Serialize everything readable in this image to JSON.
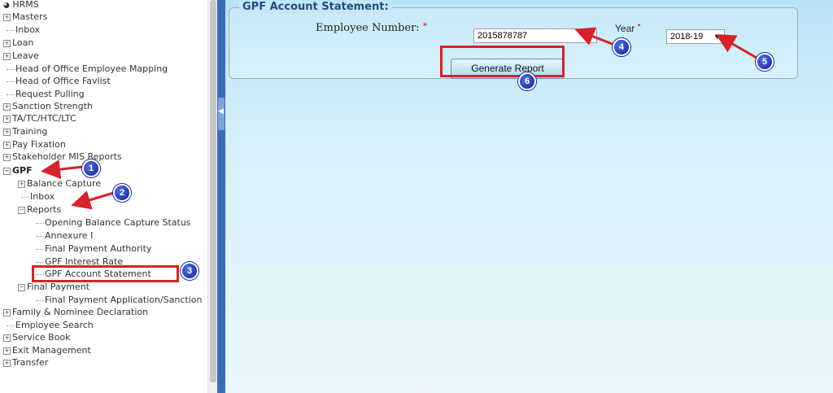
{
  "sidebar": {
    "items": [
      {
        "label": "HRMS",
        "prefix": "icon"
      },
      {
        "label": "Masters",
        "prefix": "plus"
      },
      {
        "label": "Inbox",
        "prefix": "dots"
      },
      {
        "label": "Loan",
        "prefix": "plus"
      },
      {
        "label": "Leave",
        "prefix": "plus"
      },
      {
        "label": "Head of Office Employee Mapping",
        "prefix": "dots"
      },
      {
        "label": "Head of Office Favlist",
        "prefix": "dots"
      },
      {
        "label": "Request Pulling",
        "prefix": "dots"
      },
      {
        "label": "Sanction Strength",
        "prefix": "plus"
      },
      {
        "label": "TA/TC/HTC/LTC",
        "prefix": "plus"
      },
      {
        "label": "Training",
        "prefix": "plus"
      },
      {
        "label": "Pay Fixation",
        "prefix": "plus"
      },
      {
        "label": "Stakeholder MIS Reports",
        "prefix": "plus"
      },
      {
        "label": "GPF",
        "prefix": "minus"
      },
      {
        "label": "Balance Capture",
        "prefix": "plus"
      },
      {
        "label": "Inbox",
        "prefix": "dots"
      },
      {
        "label": "Reports",
        "prefix": "minus"
      },
      {
        "label": "Opening Balance Capture Status",
        "prefix": "dots"
      },
      {
        "label": "Annexure I",
        "prefix": "dots"
      },
      {
        "label": "Final Payment Authority",
        "prefix": "dots"
      },
      {
        "label": "GPF Interest Rate",
        "prefix": "dots"
      },
      {
        "label": "GPF Account Statement",
        "prefix": "dots"
      },
      {
        "label": "Final Payment",
        "prefix": "minus"
      },
      {
        "label": "Final Payment Application/Sanction",
        "prefix": "dots"
      },
      {
        "label": "Family & Nominee Declaration",
        "prefix": "plus"
      },
      {
        "label": "Employee Search",
        "prefix": "dots"
      },
      {
        "label": "Service Book",
        "prefix": "plus"
      },
      {
        "label": "Exit Management",
        "prefix": "plus"
      },
      {
        "label": "Transfer",
        "prefix": "plus"
      }
    ]
  },
  "form": {
    "legend": "GPF Account Statement:",
    "employee_label": "Employee Number:",
    "required_mark": "*",
    "employee_value": "2015878787",
    "year_label": "Year",
    "year_value": "2018-19",
    "year_arrow": "▼",
    "generate_label": "Generate Report"
  },
  "markers": [
    "1",
    "2",
    "3",
    "4",
    "5",
    "6"
  ],
  "colors": {
    "annotation_red": "#d4232a",
    "marker_blue": "#10209a",
    "panel_bg": "#c7e9f8"
  }
}
